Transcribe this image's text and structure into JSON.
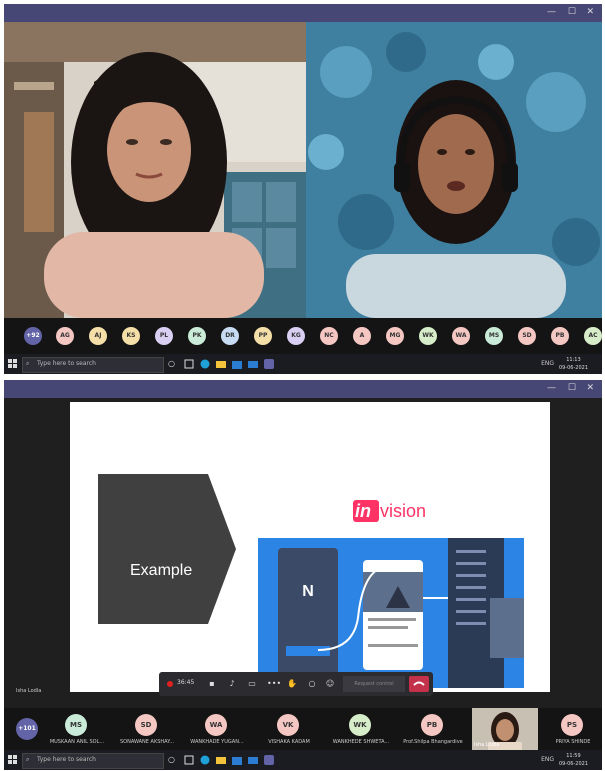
{
  "call1": {
    "overflow_count": "+92",
    "participants": [
      {
        "initials": "AG",
        "color": "#f4c7c3"
      },
      {
        "initials": "AJ",
        "color": "#f5dfa8"
      },
      {
        "initials": "KS",
        "color": "#f5dfa8"
      },
      {
        "initials": "PL",
        "color": "#d9cff2"
      },
      {
        "initials": "PK",
        "color": "#c9ebd7"
      },
      {
        "initials": "DR",
        "color": "#c7dcf2"
      },
      {
        "initials": "PP",
        "color": "#f5dfa8"
      },
      {
        "initials": "KG",
        "color": "#d9cff2"
      },
      {
        "initials": "NC",
        "color": "#f4c7c3"
      },
      {
        "initials": "A",
        "color": "#f4c7c3"
      },
      {
        "initials": "MG",
        "color": "#f4c7c3"
      },
      {
        "initials": "WK",
        "color": "#d7ecc9"
      },
      {
        "initials": "WA",
        "color": "#f4c7c3"
      },
      {
        "initials": "MS",
        "color": "#c9ebd7"
      },
      {
        "initials": "SD",
        "color": "#f4c7c3"
      },
      {
        "initials": "PB",
        "color": "#f4c7c3"
      },
      {
        "initials": "AC",
        "color": "#d7ecc9"
      }
    ],
    "taskbar": {
      "search_placeholder": "Type here to search",
      "time": "11:13",
      "date": "09-06-2021",
      "tray": "ENG"
    }
  },
  "call2": {
    "slide": {
      "example_label": "Example",
      "logo_in": "in",
      "logo_rest": "vision"
    },
    "presenter_label": "Isha Lodla",
    "toolbar": {
      "rec_time": "36:45",
      "request_control": "Request control"
    },
    "overflow_count": "+101",
    "participants": [
      {
        "initials": "MS",
        "name": "MUSKAAN ANIL SOL...",
        "color": "#c9ebd7"
      },
      {
        "initials": "SD",
        "name": "SONAWANE AKSHAY...",
        "color": "#f4c7c3"
      },
      {
        "initials": "WA",
        "name": "WANKHADE YUGAN...",
        "color": "#f4c7c3"
      },
      {
        "initials": "VK",
        "name": "VISHAKA KADAM",
        "color": "#f4c7c3"
      },
      {
        "initials": "WK",
        "name": "WANKHEDE SHWETA...",
        "color": "#d7ecc9"
      },
      {
        "initials": "PB",
        "name": "Prof.Shilpa Bhangardive",
        "color": "#f4c7c3"
      },
      {
        "initials": "PS",
        "name": "PRIYA SHINDE",
        "color": "#f4c7c3"
      }
    ],
    "self_view_label": "Isha Lodla",
    "taskbar": {
      "search_placeholder": "Type here to search",
      "time": "11:59",
      "date": "09-06-2021",
      "tray": "ENG"
    }
  },
  "colors": {
    "teams_purple": "#464775",
    "hangup_red": "#c4314b",
    "invision_pink": "#ff3366",
    "invision_blue": "#2c84e4"
  }
}
